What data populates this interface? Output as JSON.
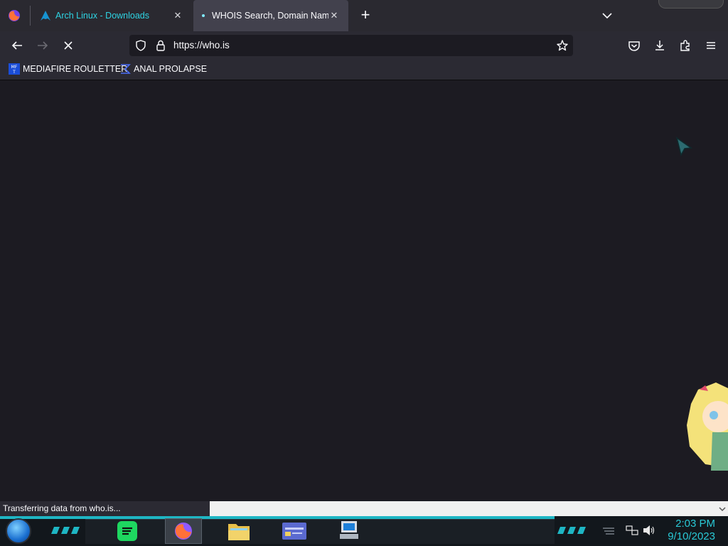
{
  "browser": {
    "tabs": [
      {
        "title": "Arch Linux - Downloads",
        "active": false
      },
      {
        "title": "WHOIS Search, Domain Name, Website, and IP Tools",
        "active": true
      }
    ],
    "url": "https://who.is",
    "loading": true,
    "bookmarks": [
      {
        "label": "MEDIAFIRE ROULETTER",
        "icon": "mediafire-icon"
      },
      {
        "label": "ANAL PROLAPSE",
        "icon": "sigma-icon"
      }
    ],
    "status_text": "Transferring data from who.is...",
    "accent_color": "#2ed4e3"
  },
  "taskbar": {
    "time": "2:03 PM",
    "date": "9/10/2023",
    "clock_color": "#29c9d6",
    "apps": [
      "spotify-icon",
      "firefox-icon",
      "file-explorer-icon",
      "window-icon",
      "computer-icon"
    ]
  }
}
